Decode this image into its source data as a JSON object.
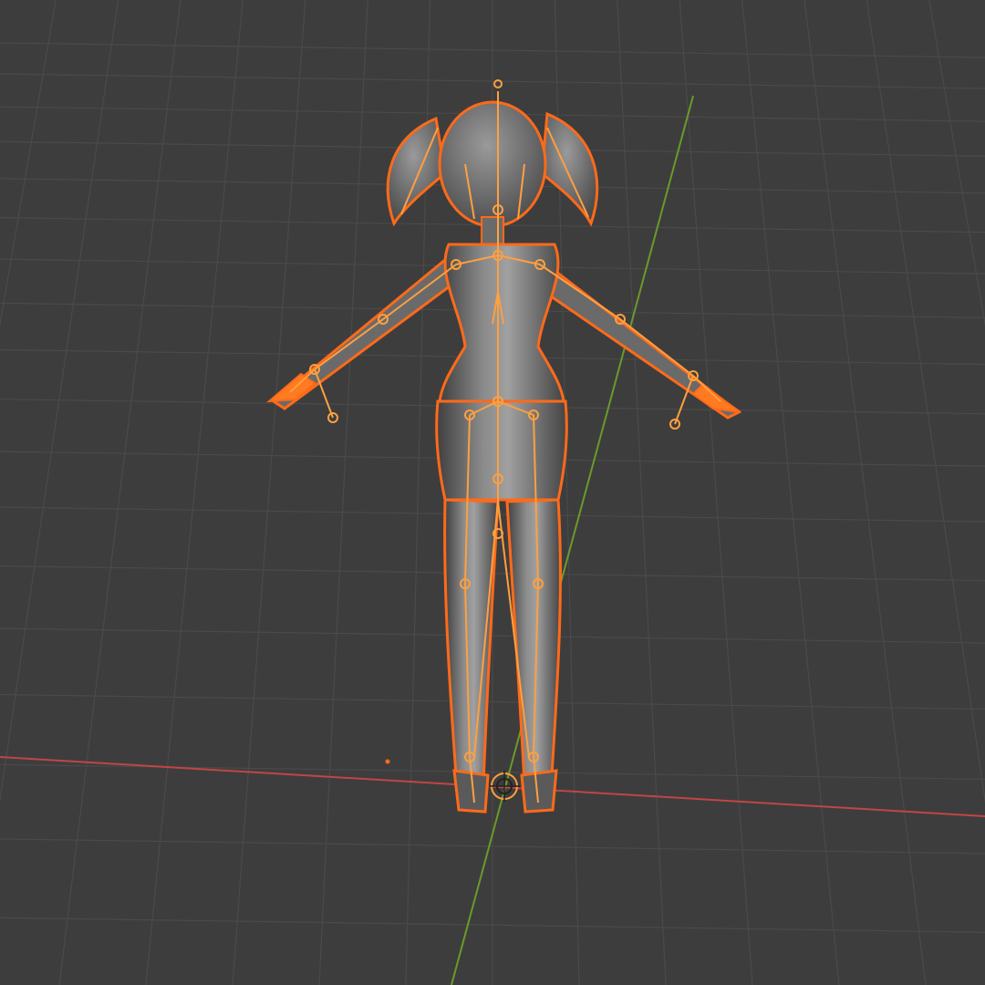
{
  "app": "Blender",
  "viewport": {
    "view": "perspective",
    "shading": "solid",
    "grid_visible": true,
    "axes_visible": [
      "x",
      "y"
    ]
  },
  "scene": {
    "object_mesh": "character-body-mesh",
    "object_armature": "character-armature",
    "mode": "object",
    "selection_state": "selected"
  },
  "colors": {
    "background": "#3d3d3d",
    "grid_line": "#4a4a4a",
    "grid_line_major": "#545454",
    "axis_x": "#c24545",
    "axis_y": "#6b9a2a",
    "selection_outline": "#ff6a1a",
    "armature_bone": "#ffa040",
    "mesh_solid": "#7a7a7a",
    "mesh_shade_dark": "#3e3e3e",
    "mesh_shade_light": "#9a9a9a"
  },
  "icons": {
    "cursor": "3d-cursor-icon"
  }
}
